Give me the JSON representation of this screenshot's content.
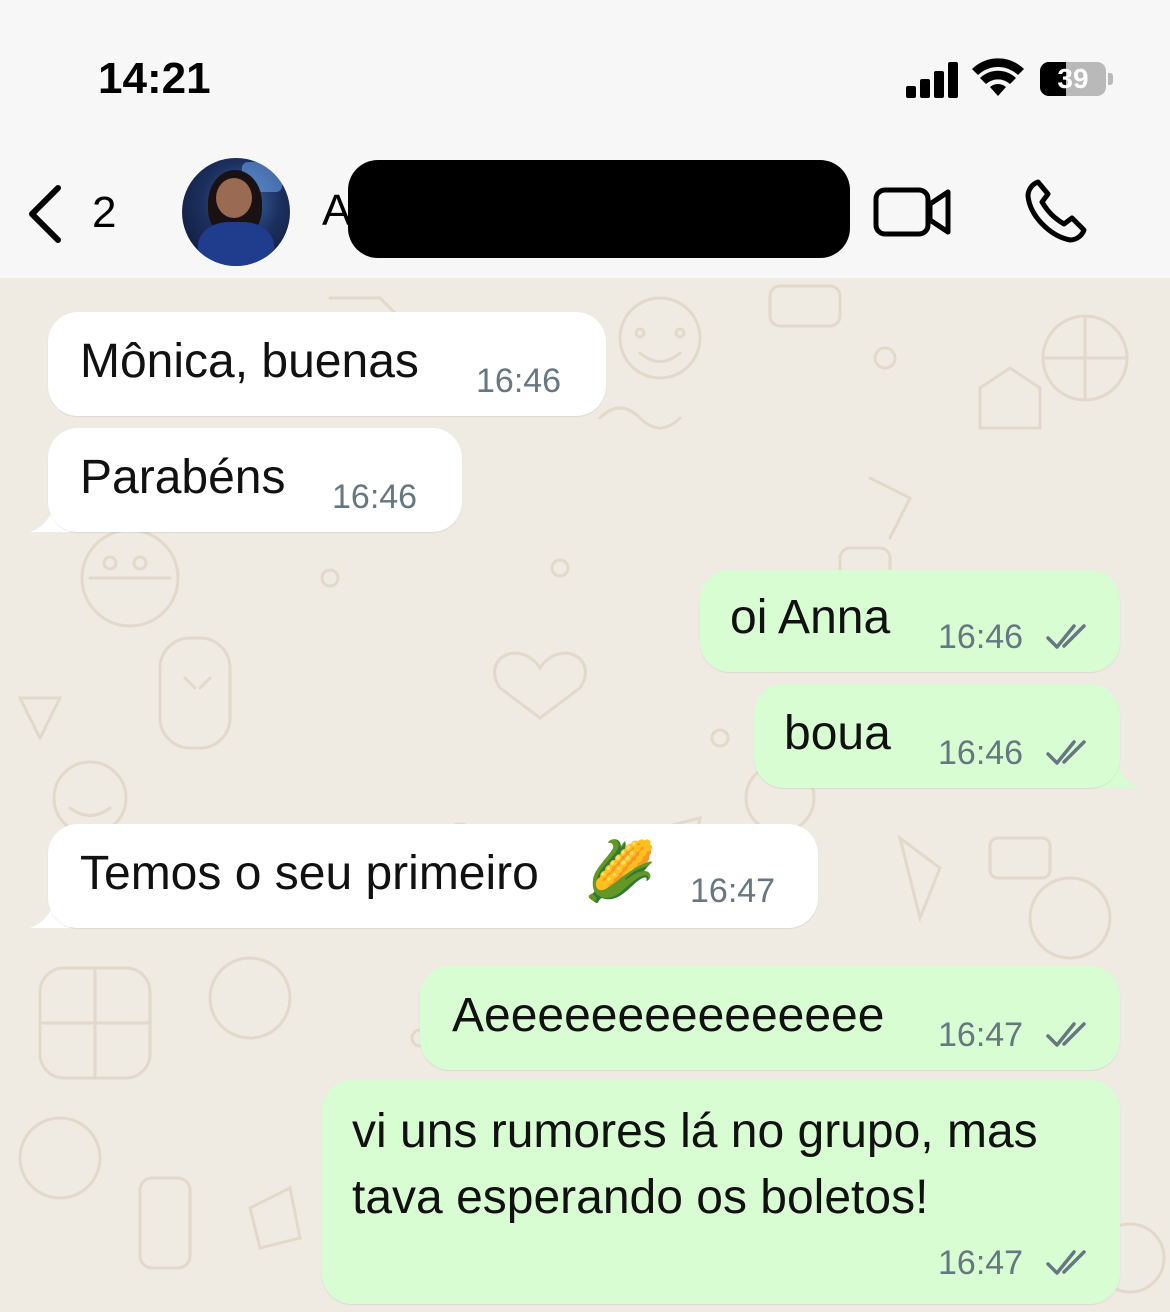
{
  "status_bar": {
    "time": "14:21",
    "battery": "39",
    "battery_level": 0.39,
    "icons": [
      "cellular-signal-icon",
      "wifi-icon",
      "battery-icon"
    ]
  },
  "header": {
    "back_icon": "chevron-left-icon",
    "unread_count": "2",
    "contact_name_visible": "A",
    "contact_name_redacted": true,
    "actions": [
      "video-call-icon",
      "phone-icon"
    ]
  },
  "messages": [
    {
      "direction": "incoming",
      "text": "Mônica, buenas",
      "time": "16:46"
    },
    {
      "direction": "incoming",
      "text": "Parabéns",
      "time": "16:46"
    },
    {
      "direction": "outgoing",
      "text": "oi Anna",
      "time": "16:46",
      "status": "read"
    },
    {
      "direction": "outgoing",
      "text": "boua",
      "time": "16:46",
      "status": "read"
    },
    {
      "direction": "incoming",
      "text": "Temos o seu primeiro",
      "emoji": "🌽",
      "time": "16:47"
    },
    {
      "direction": "outgoing",
      "text": "Aeeeeeeeeeeeeeee",
      "time": "16:47",
      "status": "read"
    },
    {
      "direction": "outgoing",
      "lines": [
        "vi uns rumores lá no grupo, mas",
        "tava esperando  os boletos!"
      ],
      "time": "16:47",
      "status": "read"
    }
  ],
  "colors": {
    "incoming_bubble": "#ffffff",
    "outgoing_bubble": "#d9fdd3",
    "chat_background": "#efeae2",
    "header_background": "#f7f7f7",
    "timestamp": "#667781",
    "read_ticks": "#667781"
  }
}
